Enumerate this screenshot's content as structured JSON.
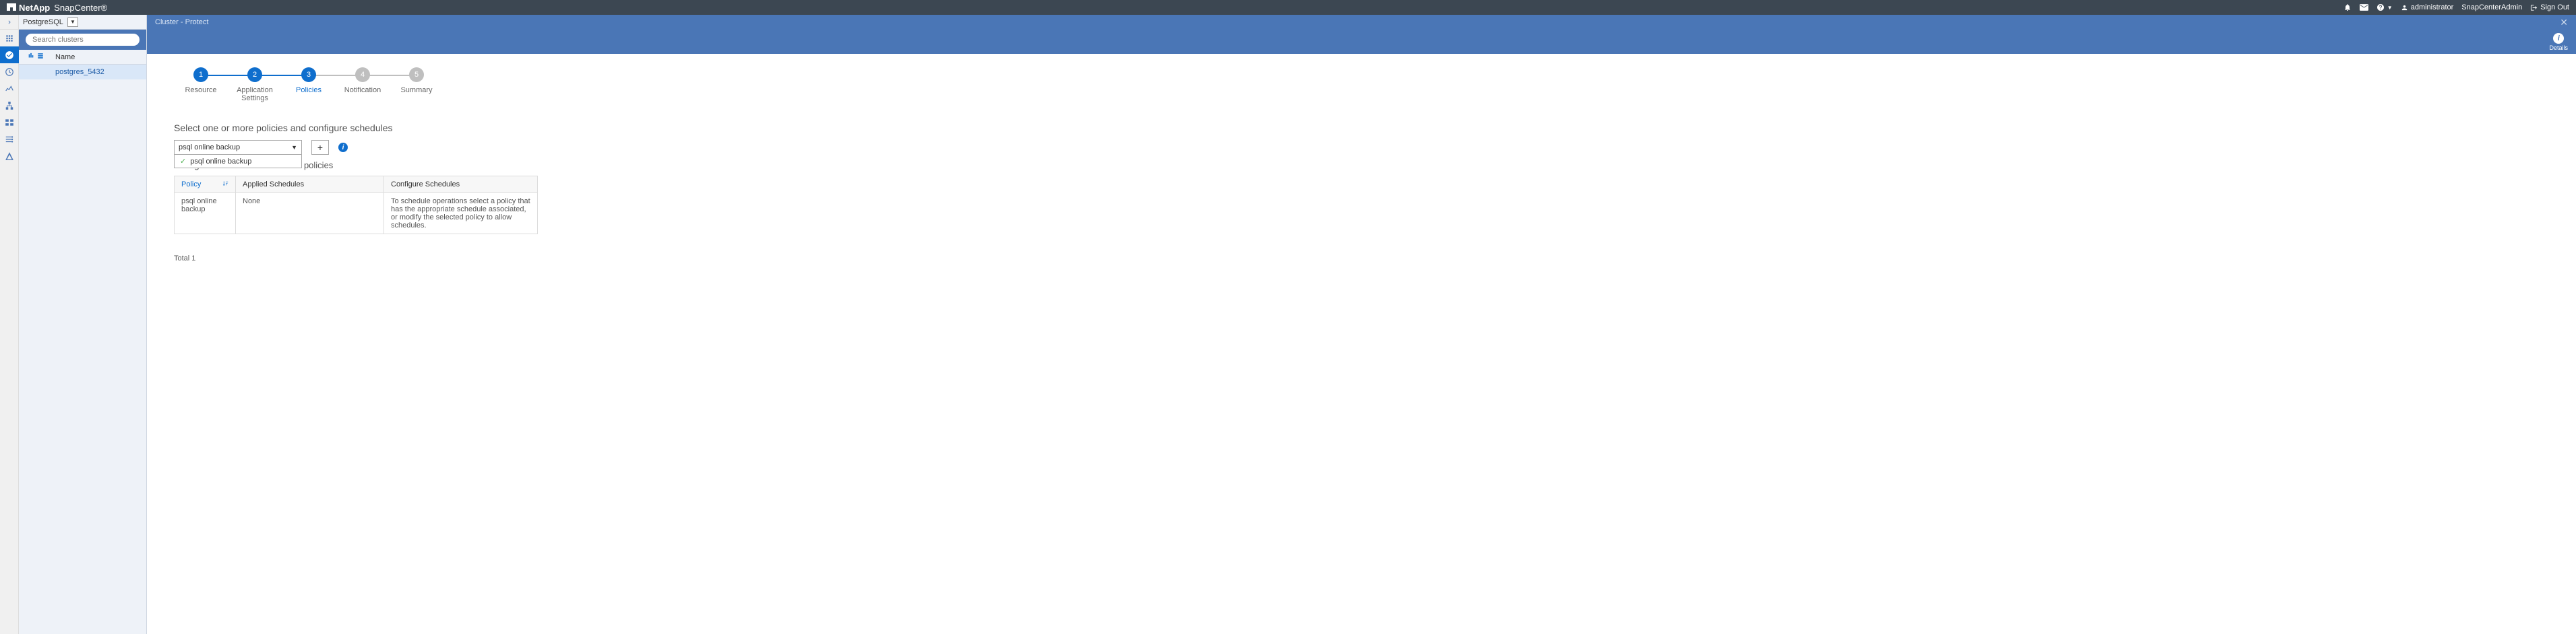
{
  "header": {
    "brand_netapp": "NetApp",
    "brand_product": "SnapCenter®",
    "user": "administrator",
    "role": "SnapCenterAdmin",
    "signout": "Sign Out"
  },
  "sidebar": {
    "title": "PostgreSQL",
    "search_placeholder": "Search clusters",
    "col_name": "Name",
    "items": [
      {
        "name": "postgres_5432"
      }
    ]
  },
  "crumb": "Cluster - Protect",
  "details_label": "Details",
  "steps": [
    {
      "num": "1",
      "label": "Resource",
      "state": "done"
    },
    {
      "num": "2",
      "label": "Application Settings",
      "state": "done"
    },
    {
      "num": "3",
      "label": "Policies",
      "state": "active"
    },
    {
      "num": "4",
      "label": "Notification",
      "state": "pending"
    },
    {
      "num": "5",
      "label": "Summary",
      "state": "pending"
    }
  ],
  "policies": {
    "heading": "Select one or more policies and configure schedules",
    "selected": "psql online backup",
    "options": [
      {
        "label": "psql online backup",
        "checked": true
      }
    ],
    "schedules_heading": "Configure schedules for selected policies",
    "table": {
      "col_policy": "Policy",
      "col_applied": "Applied Schedules",
      "col_config": "Configure Schedules",
      "rows": [
        {
          "policy": "psql online backup",
          "applied": "None",
          "config": "To schedule operations select a policy that has the appropriate schedule associated, or modify the selected policy to allow schedules."
        }
      ]
    },
    "total": "Total 1"
  }
}
